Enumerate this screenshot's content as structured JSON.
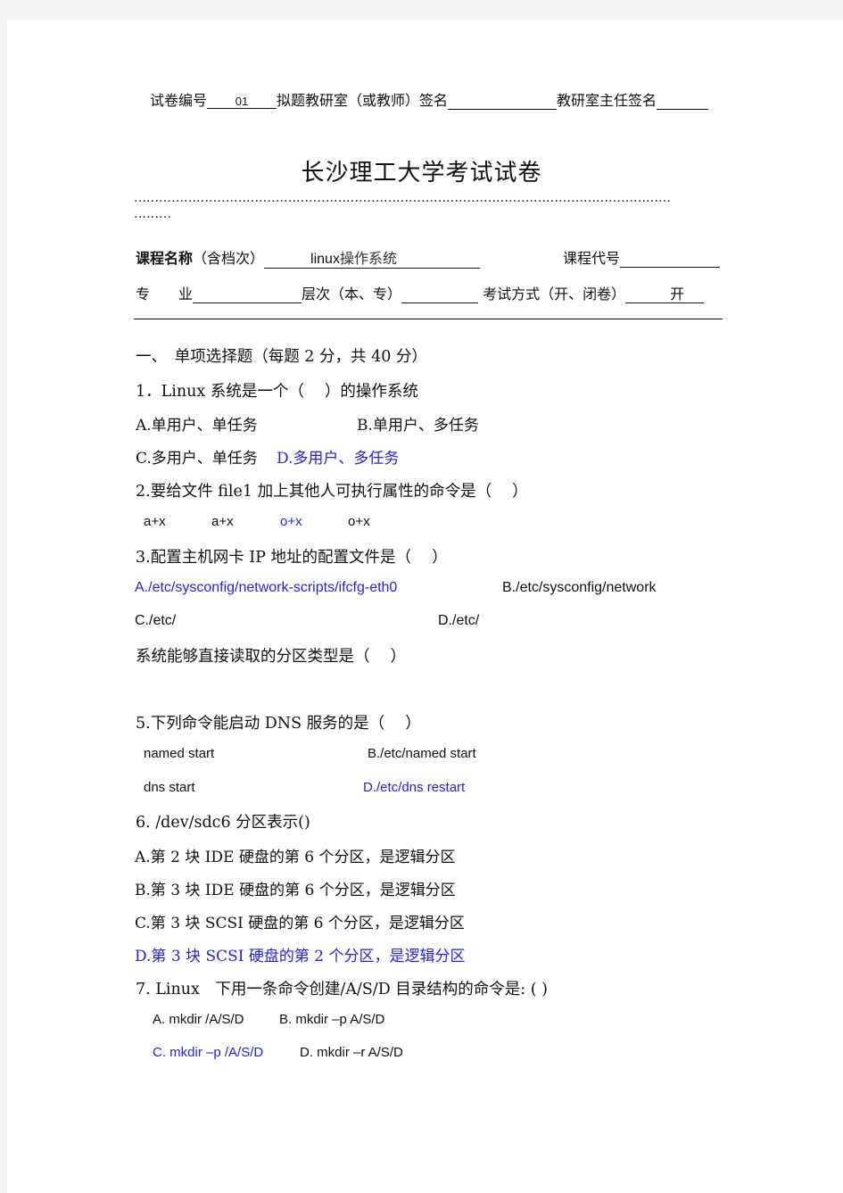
{
  "header": {
    "paper_no_label": "试卷编号",
    "paper_no_value": "01",
    "setter_label": "拟题教研室（或教师）签名",
    "setter_value": "",
    "director_label": "教研室主任签名",
    "director_value": ""
  },
  "title": "长沙理工大学考试试卷",
  "dots_line1": "…………………………………………………………………………………………………………………",
  "dots_line2": "………",
  "course": {
    "name_label_bold": "课程名称",
    "name_label_rest": "（含档次）",
    "name_value_latin": "linux",
    "name_value_cn": "操作系统",
    "code_label": "课程代号",
    "code_value": "",
    "major_label": "专　　业",
    "major_value": "",
    "level_label": "层次（本、专）",
    "level_value": "",
    "exam_mode_label": "考试方式（开、闭卷）",
    "exam_mode_value": "开"
  },
  "section": {
    "title": "一、　单项选择题（每题 2 分，共 40 分）"
  },
  "questions": [
    {
      "stem": "1．Linux 系统是一个（　 ）的操作系统",
      "options": [
        {
          "text": "A.单用户、单任务",
          "answer": false
        },
        {
          "text": "B.单用户、多任务",
          "answer": false
        },
        {
          "text": "C.多用户、单任务",
          "answer": false
        },
        {
          "text": "D.多用户、多任务",
          "answer": true
        }
      ]
    },
    {
      "stem": "2.要给文件 file1 加上其他人可执行属性的命令是（　 ）",
      "options": [
        {
          "text": "a+x",
          "answer": false
        },
        {
          "text": "a+x",
          "answer": false
        },
        {
          "text": "o+x",
          "answer": true
        },
        {
          "text": "o+x",
          "answer": false
        }
      ]
    },
    {
      "stem": "3.配置主机网卡 IP 地址的配置文件是（　 ）",
      "options": [
        {
          "text": "A./etc/sysconfig/network-scripts/ifcfg-eth0",
          "answer": true
        },
        {
          "text": "B./etc/sysconfig/network",
          "answer": false
        },
        {
          "text": "C./etc/",
          "answer": false
        },
        {
          "text": "D./etc/",
          "answer": false
        }
      ]
    },
    {
      "stem": "系统能够直接读取的分区类型是（　 ）",
      "options": []
    },
    {
      "stem": "5.下列命令能启动 DNS 服务的是（　 ）",
      "options": [
        {
          "text": "named  start",
          "answer": false
        },
        {
          "text": "B./etc/named  start",
          "answer": false
        },
        {
          "text": "dns  start",
          "answer": false
        },
        {
          "text": "D./etc/dns  restart",
          "answer": true
        }
      ]
    },
    {
      "stem": "6.  /dev/sdc6 分区表示()",
      "options": [
        {
          "text": "A.第 2 块 IDE 硬盘的第 6 个分区，是逻辑分区",
          "answer": false
        },
        {
          "text": "B.第 3 块 IDE 硬盘的第 6 个分区，是逻辑分区",
          "answer": false
        },
        {
          "text": "C.第 3 块 SCSI 硬盘的第 6 个分区，是逻辑分区",
          "answer": false
        },
        {
          "text": "D.第 3 块 SCSI 硬盘的第 2 个分区，是逻辑分区",
          "answer": true
        }
      ]
    },
    {
      "stem": "7. Linux　下用一条命令创建/A/S/D 目录结构的命令是: ( )",
      "options": [
        {
          "text": "A.  mkdir  /A/S/D",
          "answer": false
        },
        {
          "text": "B.  mkdir  –p  A/S/D",
          "answer": false
        },
        {
          "text": "C.  mkdir  –p  /A/S/D",
          "answer": true
        },
        {
          "text": "D.  mkdir  –r  A/S/D",
          "answer": false
        }
      ]
    }
  ],
  "colors": {
    "answer": "#2323e0",
    "text": "#111111",
    "background": "#f3f3f3",
    "sheet": "#ffffff"
  }
}
